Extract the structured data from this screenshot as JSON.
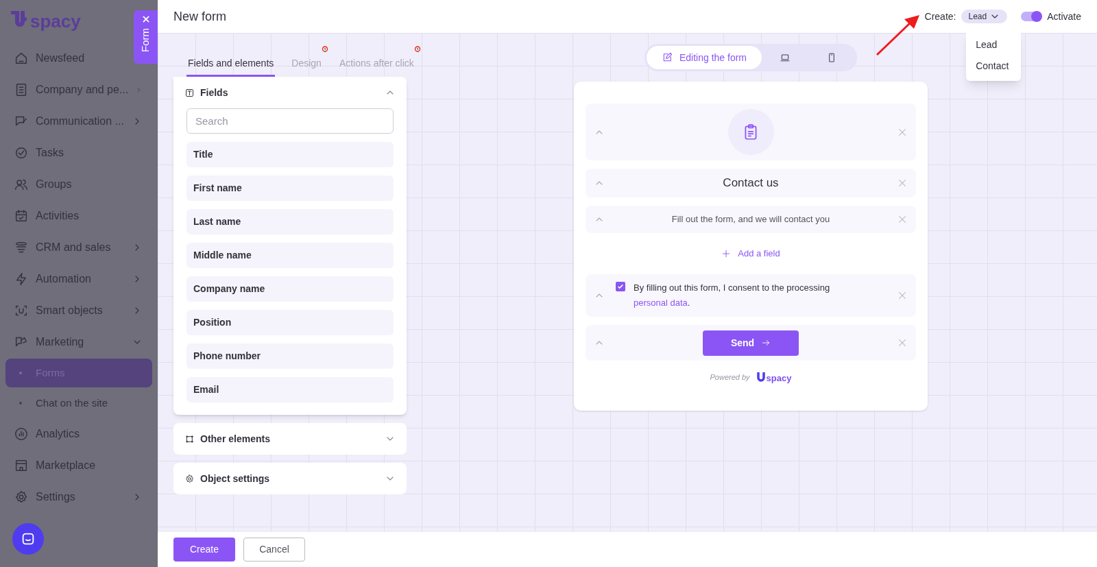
{
  "sidebar": {
    "logo": "spacy",
    "items": [
      {
        "label": "Newsfeed",
        "expandable": false
      },
      {
        "label": "Company and pe...",
        "expandable": true,
        "expanded": false
      },
      {
        "label": "Communication ...",
        "expandable": true,
        "expanded": false
      },
      {
        "label": "Tasks",
        "expandable": false
      },
      {
        "label": "Groups",
        "expandable": false
      },
      {
        "label": "Activities",
        "expandable": false
      },
      {
        "label": "CRM and sales",
        "expandable": true,
        "expanded": false
      },
      {
        "label": "Automation",
        "expandable": true,
        "expanded": false
      },
      {
        "label": "Smart objects",
        "expandable": true,
        "expanded": false
      },
      {
        "label": "Marketing",
        "expandable": true,
        "expanded": true,
        "children": [
          {
            "label": "Forms",
            "selected": true
          },
          {
            "label": "Chat on the site",
            "selected": false
          }
        ]
      },
      {
        "label": "Analytics",
        "expandable": false
      },
      {
        "label": "Marketplace",
        "expandable": false
      },
      {
        "label": "Settings",
        "expandable": true,
        "expanded": false
      }
    ]
  },
  "side_tab": {
    "label": "Form"
  },
  "header": {
    "title": "New form",
    "create_label": "Create:",
    "create_value": "Lead",
    "dropdown_open": true,
    "options": [
      {
        "label": "Lead"
      },
      {
        "label": "Contact"
      }
    ],
    "activate": {
      "label": "Activate",
      "on": true
    }
  },
  "tabs": [
    {
      "label": "Fields and elements",
      "selected": true,
      "alert": false
    },
    {
      "label": "Design",
      "selected": false,
      "alert": true
    },
    {
      "label": "Actions after click",
      "selected": false,
      "alert": true
    }
  ],
  "sections": [
    {
      "title": "Fields",
      "expanded": true,
      "search_placeholder": "Search",
      "items": [
        "Title",
        "First name",
        "Last name",
        "Middle name",
        "Company name",
        "Position",
        "Phone number",
        "Email"
      ]
    },
    {
      "title": "Other elements",
      "expanded": false
    },
    {
      "title": "Object settings",
      "expanded": false
    }
  ],
  "view_modes": [
    {
      "kind": "edit",
      "label": "Editing the form",
      "selected": true
    },
    {
      "kind": "desktop",
      "selected": false
    },
    {
      "kind": "mobile",
      "selected": false
    }
  ],
  "preview": {
    "blocks": [
      {
        "kind": "icon"
      },
      {
        "kind": "heading",
        "text": "Contact us"
      },
      {
        "kind": "text",
        "text": "Fill out the form, and we will contact you"
      },
      {
        "kind": "add",
        "text": "Add a field"
      },
      {
        "kind": "consent",
        "checked": true,
        "text": "By filling out this form, I consent to the processing",
        "link": "personal data",
        "after": "."
      },
      {
        "kind": "button",
        "text": "Send"
      }
    ],
    "powered_by": "Powered by",
    "logo": "spacy"
  },
  "footer": {
    "buttons": [
      {
        "kind": "primary",
        "label": "Create"
      },
      {
        "kind": "secondary",
        "label": "Cancel"
      }
    ]
  }
}
